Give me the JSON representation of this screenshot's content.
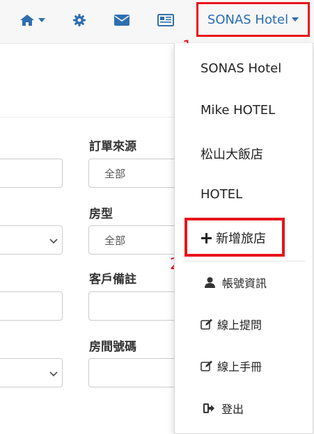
{
  "topbar": {
    "icons": [
      "home-icon",
      "gear-icon",
      "envelope-icon",
      "newspaper-icon"
    ],
    "hotel_selector_label": "SONAS Hotel",
    "accent_color": "#2a6db2"
  },
  "annotations": {
    "step1": "1.",
    "step2": "2.",
    "color": "#e8141b"
  },
  "form": {
    "order_source_label": "訂單來源",
    "order_source_value": "全部",
    "room_type_label": "房型",
    "room_type_value": "全部",
    "customer_note_label": "客戶備註",
    "room_number_label": "房間號碼"
  },
  "dropdown": {
    "hotels": [
      "SONAS Hotel",
      "Mike HOTEL",
      "松山大飯店",
      "HOTEL"
    ],
    "add_hotel": "新增旅店",
    "account_info": "帳號資訊",
    "online_question": "線上提問",
    "online_manual": "線上手冊",
    "logout": "登出"
  }
}
